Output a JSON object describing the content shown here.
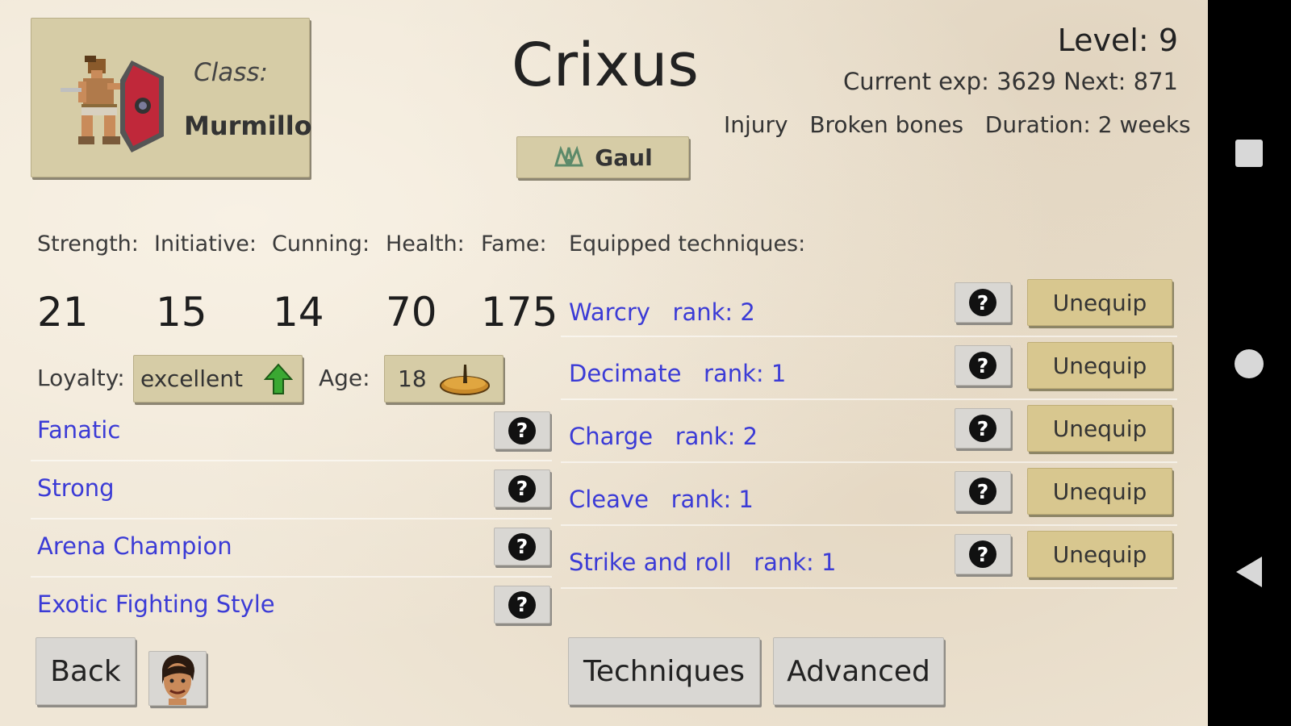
{
  "character": {
    "name": "Crixus",
    "class_label": "Class:",
    "class_value": "Murmillo",
    "origin": "Gaul",
    "level_text": "Level:  9",
    "exp_text": "Current exp: 3629  Next: 871",
    "injury_text": "Injury   Broken bones   Duration: 2 weeks"
  },
  "stats": {
    "labels": [
      "Strength:",
      "Initiative:",
      "Cunning:",
      "Health:",
      "Fame:"
    ],
    "values": [
      "21",
      "15",
      "14",
      "70",
      "175"
    ]
  },
  "loyalty": {
    "label": "Loyalty:",
    "value": "excellent"
  },
  "age": {
    "label": "Age:",
    "value": "18"
  },
  "traits": [
    "Fanatic",
    "Strong",
    "Arena Champion",
    "Exotic Fighting Style"
  ],
  "help_label": "?",
  "techniques": {
    "header": "Equipped techniques:",
    "items": [
      {
        "text": "Warcry   rank: 2"
      },
      {
        "text": "Decimate   rank: 1"
      },
      {
        "text": "Charge   rank: 2"
      },
      {
        "text": "Cleave   rank: 1"
      },
      {
        "text": "Strike and roll   rank: 1"
      }
    ],
    "unequip_label": "Unequip"
  },
  "bottom": {
    "back": "Back",
    "techniques": "Techniques",
    "advanced": "Advanced"
  },
  "colors": {
    "link": "#3b3bd6",
    "parchment": "#efe6d6",
    "button_tan": "#d6cca6",
    "button_gold": "#d8c78f",
    "button_grey": "#d9d7d3"
  },
  "icons": {
    "class": "murmillo-gladiator-icon",
    "origin": "gaul-crest-icon",
    "loyalty": "arrow-up-icon",
    "age": "sundial-icon",
    "portrait": "gladiator-portrait-icon"
  }
}
